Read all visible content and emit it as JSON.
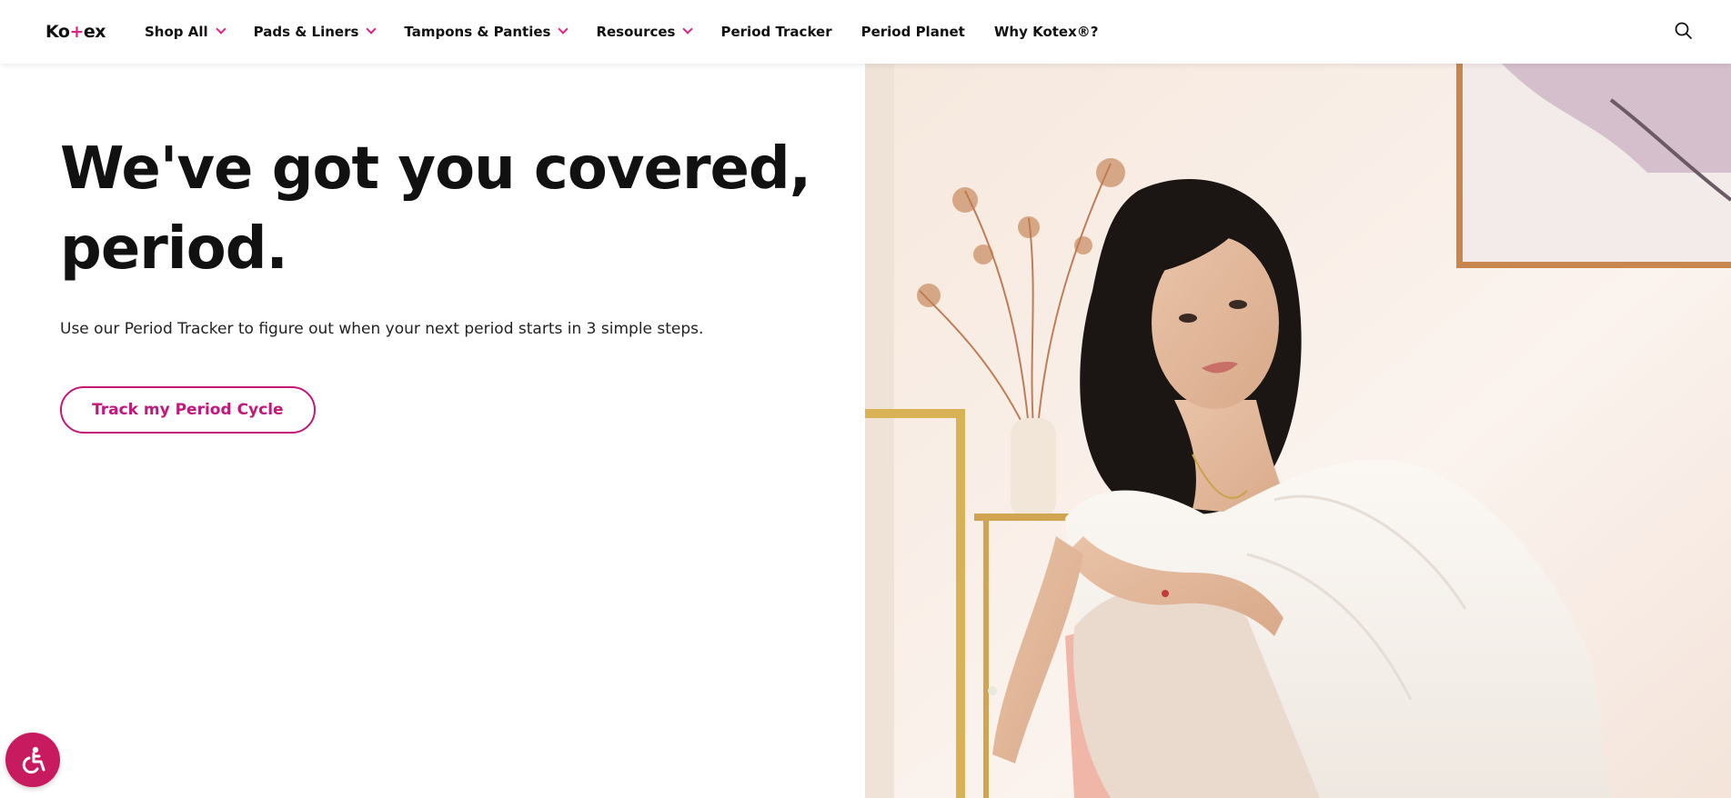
{
  "header": {
    "logo_left": "Ko",
    "logo_mid": "+",
    "logo_right": "ex",
    "nav": [
      {
        "label": "Shop All",
        "has_dropdown": true
      },
      {
        "label": "Pads & Liners",
        "has_dropdown": true
      },
      {
        "label": "Tampons & Panties",
        "has_dropdown": true
      },
      {
        "label": "Resources",
        "has_dropdown": true
      },
      {
        "label": "Period Tracker",
        "has_dropdown": false
      },
      {
        "label": "Period Planet",
        "has_dropdown": false
      },
      {
        "label": "Why Kotex®?",
        "has_dropdown": false
      }
    ],
    "search_icon": "search-icon"
  },
  "hero": {
    "title": "We've got you covered, period.",
    "subtitle": "Use our Period Tracker to figure out when your next period starts in 3 simple steps.",
    "cta_label": "Track my Period Cycle"
  },
  "accessibility_icon": "accessibility-icon",
  "colors": {
    "brand_pink": "#e0218a",
    "cta_pink": "#c4177a",
    "a11y_bg": "#c81a5f",
    "text": "#111111"
  }
}
